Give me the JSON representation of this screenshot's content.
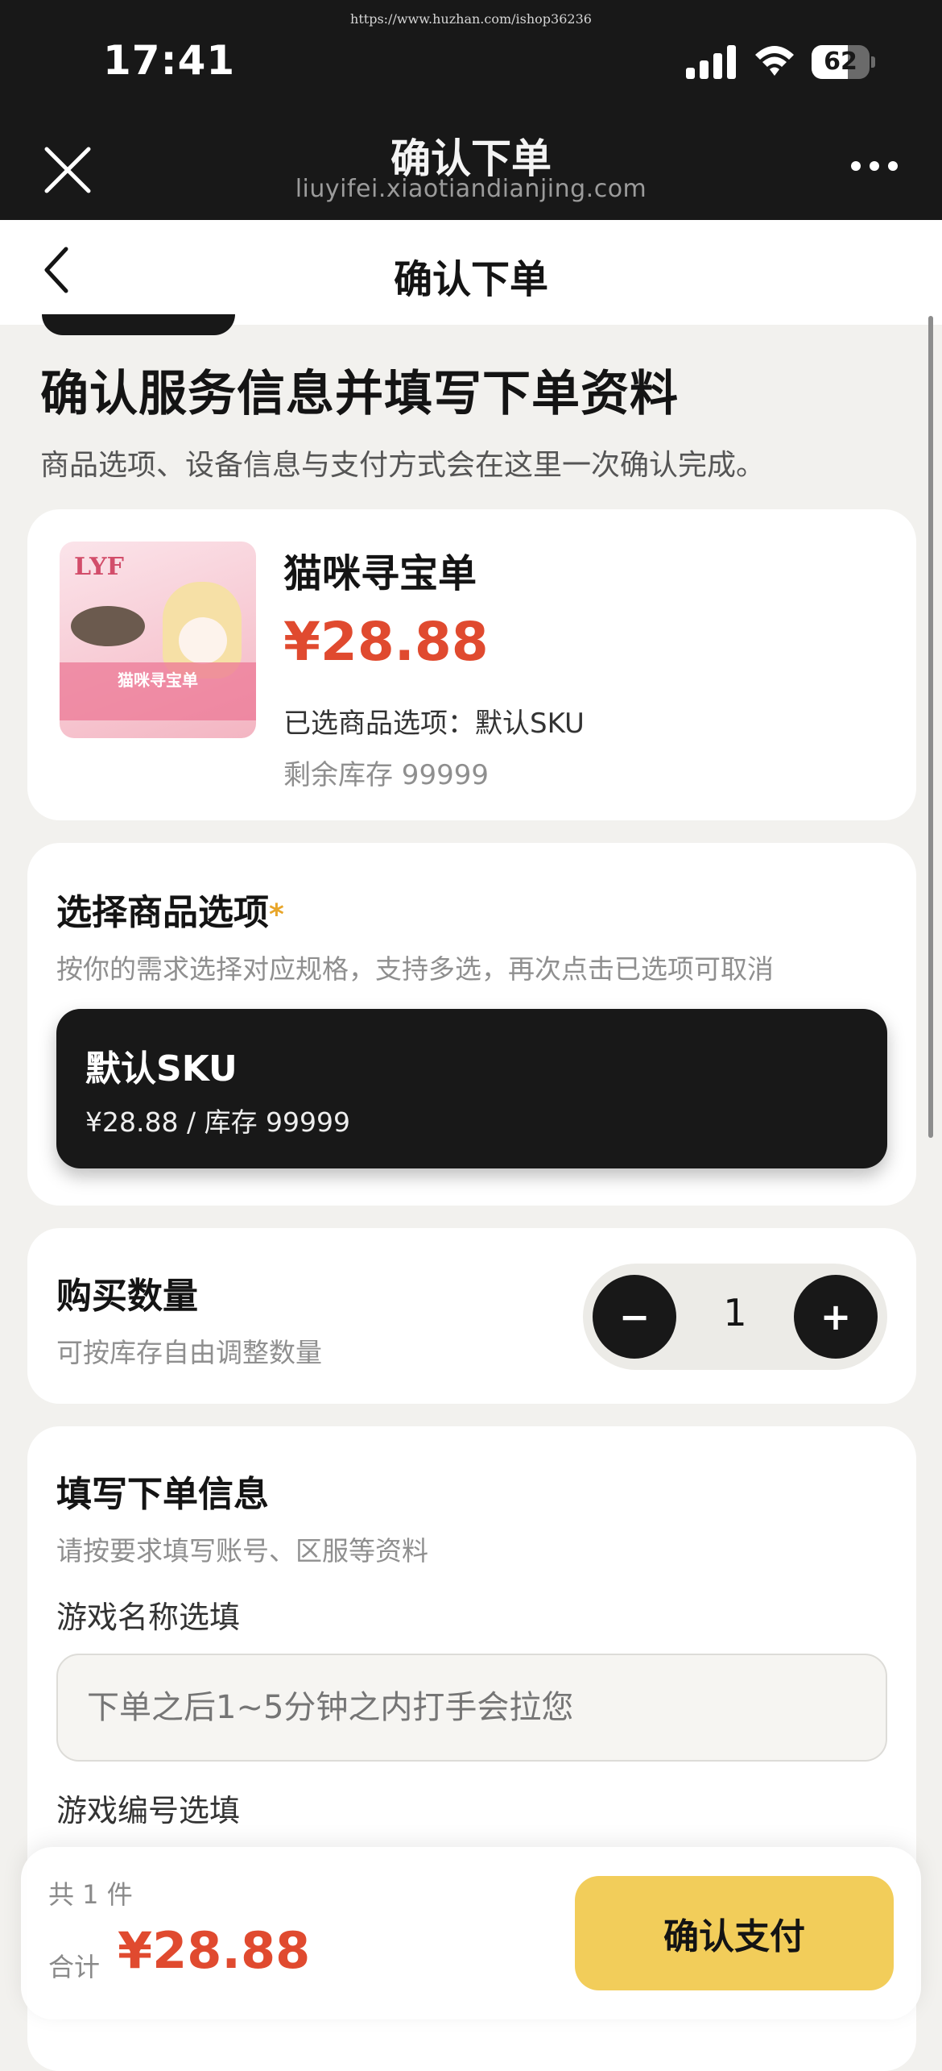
{
  "status_bar": {
    "time": "17:41",
    "battery": "62",
    "url_watermark": "https://www.huzhan.com/ishop36236"
  },
  "browser": {
    "title": "确认下单",
    "host": "liuyifei.xiaotiandianjing.com"
  },
  "navbar": {
    "title": "确认下单"
  },
  "header": {
    "title": "确认服务信息并填写下单资料",
    "subtitle": "商品选项、设备信息与支付方式会在这里一次确认完成。"
  },
  "product": {
    "name": "猫咪寻宝单",
    "price": "¥28.88",
    "selected": "已选商品选项：默认SKU",
    "stock": "剩余库存 99999",
    "image": {
      "logo": "LYF",
      "caption": "猫咪寻宝单"
    }
  },
  "options": {
    "title": "选择商品选项",
    "required_mark": "*",
    "hint": "按你的需求选择对应规格，支持多选，再次点击已选项可取消",
    "items": [
      {
        "name": "默认SKU",
        "meta": "¥28.88 / 库存 99999",
        "selected": true
      }
    ]
  },
  "quantity": {
    "title": "购买数量",
    "hint": "可按库存自由调整数量",
    "minus": "−",
    "value": "1",
    "plus": "+"
  },
  "order_info": {
    "title": "填写下单信息",
    "hint": "请按要求填写账号、区服等资料",
    "fields": [
      {
        "label": "游戏名称选填",
        "placeholder": "下单之后1~5分钟之内打手会拉您"
      },
      {
        "label": "游戏编号选填"
      }
    ]
  },
  "bottom_bar": {
    "count": "共 1 件",
    "total_label": "合计",
    "total": "¥28.88",
    "pay_button": "确认支付"
  },
  "colors": {
    "accent_price": "#e04a2f",
    "pay_button": "#f2cd5a",
    "dark": "#181818",
    "required": "#e8a62a"
  }
}
